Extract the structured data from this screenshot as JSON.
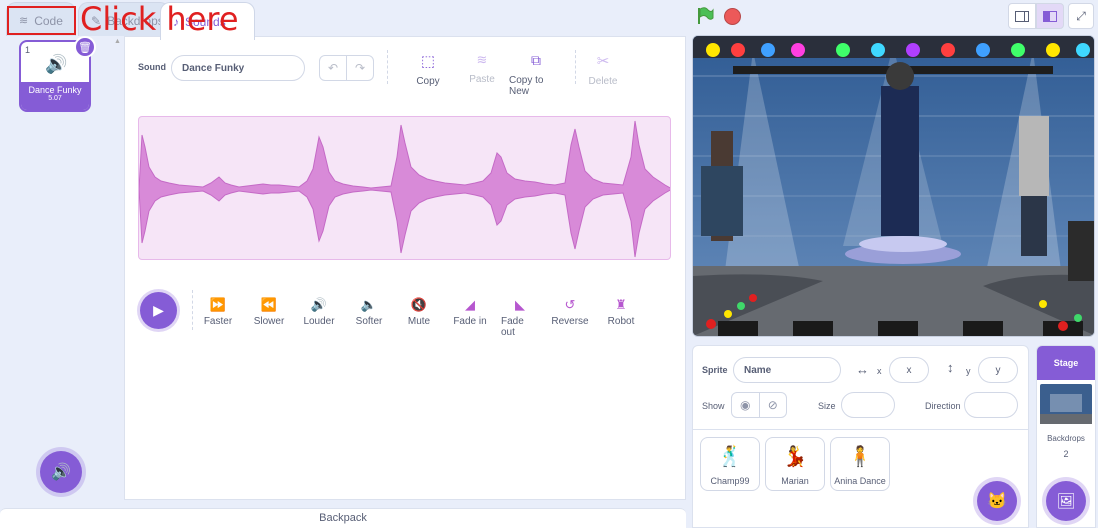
{
  "tabs": {
    "code": "Code",
    "backdrops": "Backdrops",
    "sounds": "Sounds"
  },
  "annotation": {
    "text": "Click here",
    "color": "#e02020"
  },
  "sound_list": [
    {
      "index": "1",
      "name": "Dance Funky",
      "duration": "5.07"
    }
  ],
  "editor": {
    "sound_label": "Sound",
    "sound_name": "Dance Funky",
    "actions": {
      "copy": "Copy",
      "paste": "Paste",
      "copy_to_new": "Copy to New",
      "delete": "Delete"
    },
    "effects": {
      "faster": "Faster",
      "slower": "Slower",
      "louder": "Louder",
      "softer": "Softer",
      "mute": "Mute",
      "fade_in": "Fade in",
      "fade_out": "Fade out",
      "reverse": "Reverse",
      "robot": "Robot"
    }
  },
  "backpack": {
    "label": "Backpack"
  },
  "sprite_info": {
    "sprite_label": "Sprite",
    "name_placeholder": "Name",
    "x_label": "x",
    "x_placeholder": "x",
    "y_label": "y",
    "y_placeholder": "y",
    "show_label": "Show",
    "size_label": "Size",
    "direction_label": "Direction"
  },
  "sprites": [
    {
      "name": "Champ99"
    },
    {
      "name": "Marian"
    },
    {
      "name": "Anina Dance"
    }
  ],
  "stage_panel": {
    "title": "Stage",
    "backdrops_label": "Backdrops",
    "backdrops_count": "2"
  },
  "colors": {
    "accent": "#855cd6",
    "sound": "#cf63cf",
    "green_flag": "#4cbf56",
    "stop": "#ec5959"
  }
}
